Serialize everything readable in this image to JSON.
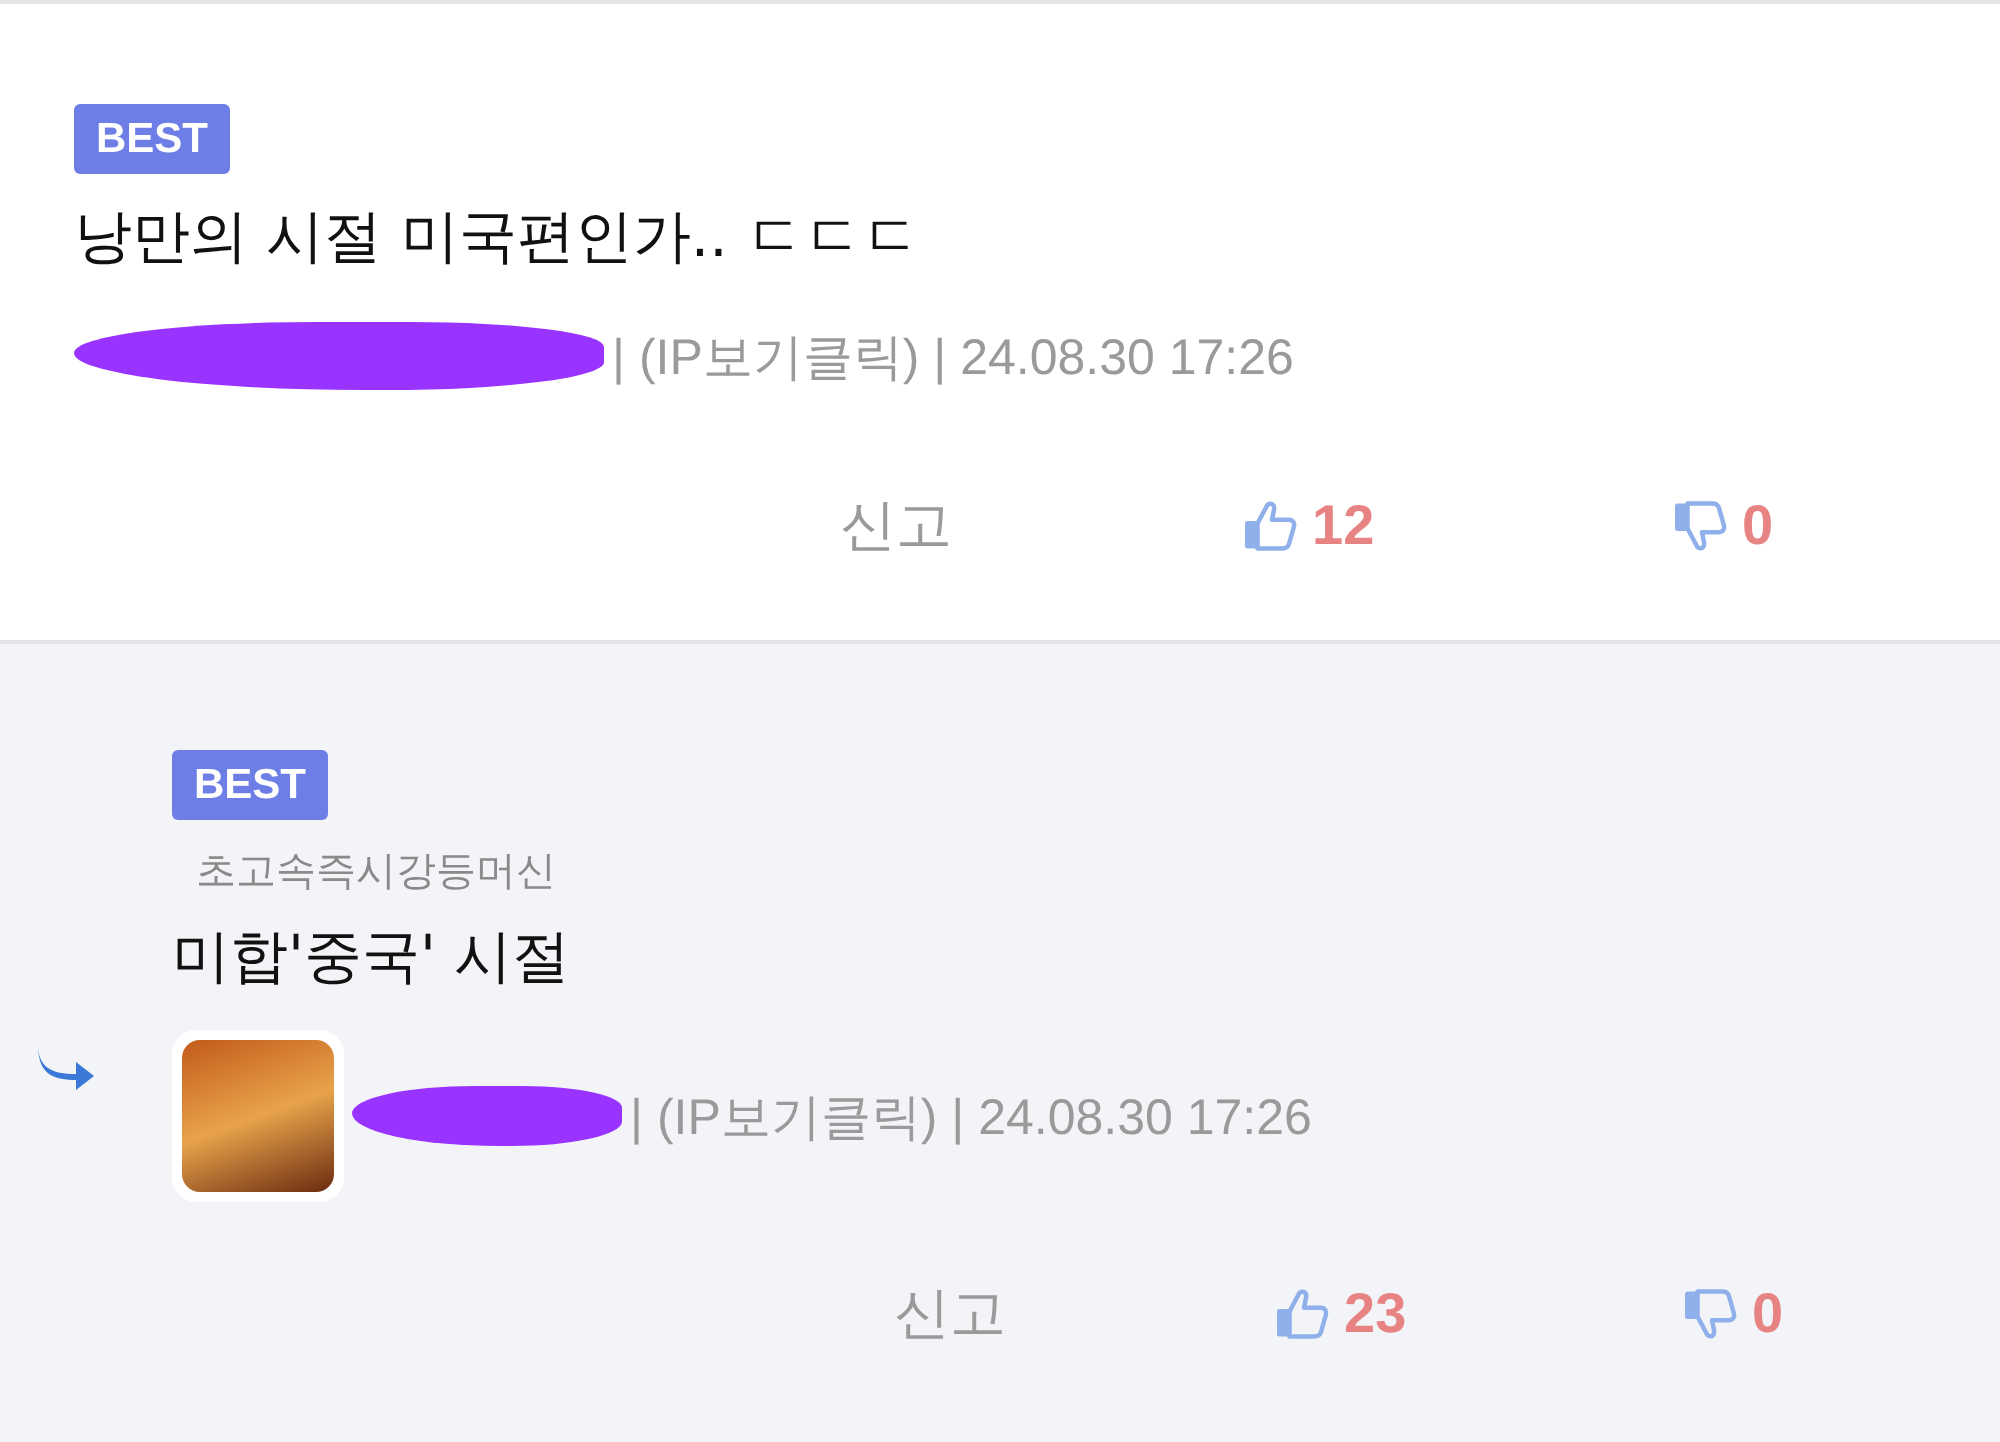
{
  "comments": [
    {
      "kind": "comment",
      "badge": "BEST",
      "title": "낭만의 시절 미국편인가.. ㄷㄷㄷ",
      "author_redacted": true,
      "meta": "| (IP보기클릭) | 24.08.30 17:26",
      "report": "신고",
      "likes": "12",
      "dislikes": "0"
    },
    {
      "kind": "reply",
      "badge": "BEST",
      "reply_to": "초고속즉시강등머신",
      "title": "미합'중국' 시절",
      "author_redacted": true,
      "meta": "| (IP보기클릭) | 24.08.30 17:26",
      "report": "신고",
      "likes": "23",
      "dislikes": "0"
    }
  ]
}
